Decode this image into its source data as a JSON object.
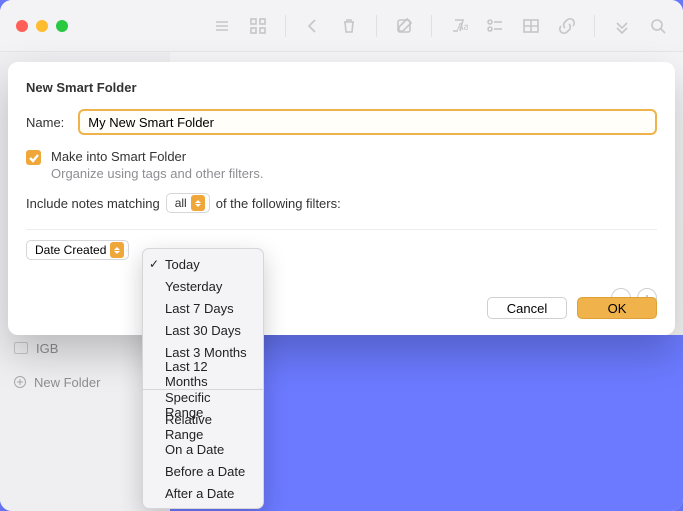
{
  "sheet": {
    "title": "New Smart Folder",
    "name_label": "Name:",
    "name_value": "My New Smart Folder",
    "checkbox_label": "Make into Smart Folder",
    "checkbox_sub": "Organize using tags and other filters.",
    "match_pre": "Include notes matching",
    "match_mode": "all",
    "match_post": "of the following filters:",
    "filter_field": "Date Created",
    "buttons": {
      "cancel": "Cancel",
      "ok": "OK"
    }
  },
  "menu": {
    "group1": [
      "Today",
      "Yesterday",
      "Last 7 Days",
      "Last 30 Days",
      "Last 3 Months",
      "Last 12 Months"
    ],
    "group2": [
      "Specific Range",
      "Relative Range",
      "On a Date",
      "Before a Date",
      "After a Date"
    ],
    "selected": "Today"
  },
  "sidebar": {
    "item": "IGB",
    "new_folder": "New Folder"
  }
}
